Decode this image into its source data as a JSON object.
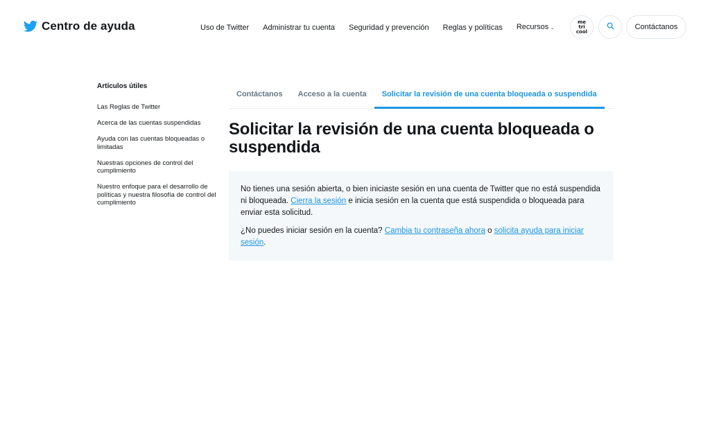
{
  "header": {
    "brand_title": "Centro de ayuda",
    "nav": [
      {
        "label": "Uso de Twitter"
      },
      {
        "label": "Administrar tu cuenta"
      },
      {
        "label": "Seguridad y prevención"
      },
      {
        "label": "Reglas y políticas"
      },
      {
        "label": "Recursos"
      }
    ],
    "logo_text": "me\ntri\ncool",
    "contact_label": "Contáctanos",
    "icons": {
      "brand": "twitter-bird-icon",
      "search": "search-icon",
      "dropdown": "chevron-down-icon"
    }
  },
  "sidebar": {
    "heading": "Artículos útiles",
    "items": [
      {
        "label": "Las Reglas de Twitter"
      },
      {
        "label": "Acerca de las cuentas suspendidas"
      },
      {
        "label": "Ayuda con las cuentas bloqueadas o limitadas"
      },
      {
        "label": "Nuestras opciones de control del cumplimiento"
      },
      {
        "label": "Nuestro enfoque para el desarrollo de políticas y nuestra filosofía de control del cumplimiento"
      }
    ]
  },
  "tabs": [
    {
      "label": "Contáctanos",
      "active": false
    },
    {
      "label": "Acceso a la cuenta",
      "active": false
    },
    {
      "label": "Solicitar la revisión de una cuenta bloqueada o suspendida",
      "active": true
    }
  ],
  "main": {
    "title": "Solicitar la revisión de una cuenta bloqueada o suspendida",
    "notice": {
      "p1_text1": "No tienes una sesión abierta, o bien iniciaste sesión en una cuenta de Twitter que no está suspendida ni bloqueada.",
      "p1_link": "Cierra la sesión",
      "p1_text2": "e inicia sesión en la cuenta que está suspendida o bloqueada para enviar esta solicitud.",
      "p2_text1": "¿No puedes iniciar sesión en la cuenta?",
      "p2_link1": "Cambia tu contraseña ahora",
      "p2_text2": "o",
      "p2_link2": "solicita ayuda para iniciar sesión",
      "p2_text3": "."
    }
  },
  "colors": {
    "accent": "#1b95e0",
    "text": "#14171a",
    "muted": "#657786",
    "notice_bg": "#f5f8fa",
    "border": "#e1e8ed"
  }
}
